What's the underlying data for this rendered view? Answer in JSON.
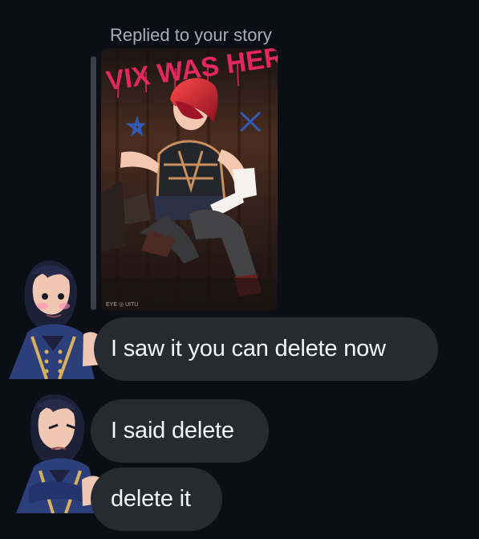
{
  "thread": {
    "reply_context": "Replied to your story",
    "story": {
      "graffiti_text": "VIX WAS HERE",
      "watermark": "EYE ◎ UITU"
    },
    "messages": [
      {
        "text": "I saw it you can delete now"
      },
      {
        "text": "I said delete"
      },
      {
        "text": "delete it"
      }
    ]
  },
  "colors": {
    "background": "#0b0f15",
    "bubble": "#262a31",
    "reply_label": "#a8adb5",
    "graffiti": "#e3275f",
    "avatar_uniform": "#2c3f7a"
  },
  "icons": {
    "reply_bar": "reply-indicator-bar"
  }
}
